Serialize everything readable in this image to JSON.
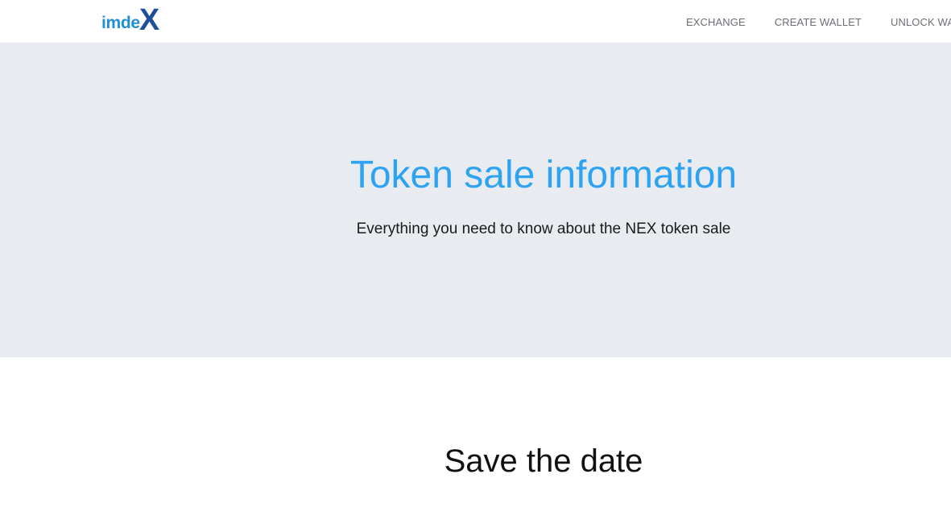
{
  "brand": {
    "logo_text": "imde",
    "logo_mark": "X",
    "colors": {
      "logo_text": "#1f8fd8",
      "logo_mark": "#1d4f9c"
    }
  },
  "nav": {
    "items": [
      {
        "label": "EXCHANGE"
      },
      {
        "label": "CREATE WALLET"
      },
      {
        "label": "UNLOCK WALLET"
      }
    ]
  },
  "hero": {
    "title": "Token sale information",
    "subtitle": "Everything you need to know about the NEX token sale",
    "colors": {
      "background": "#e8ebf0",
      "title": "#2ea3f2"
    }
  },
  "main": {
    "section_title": "Save the date"
  }
}
